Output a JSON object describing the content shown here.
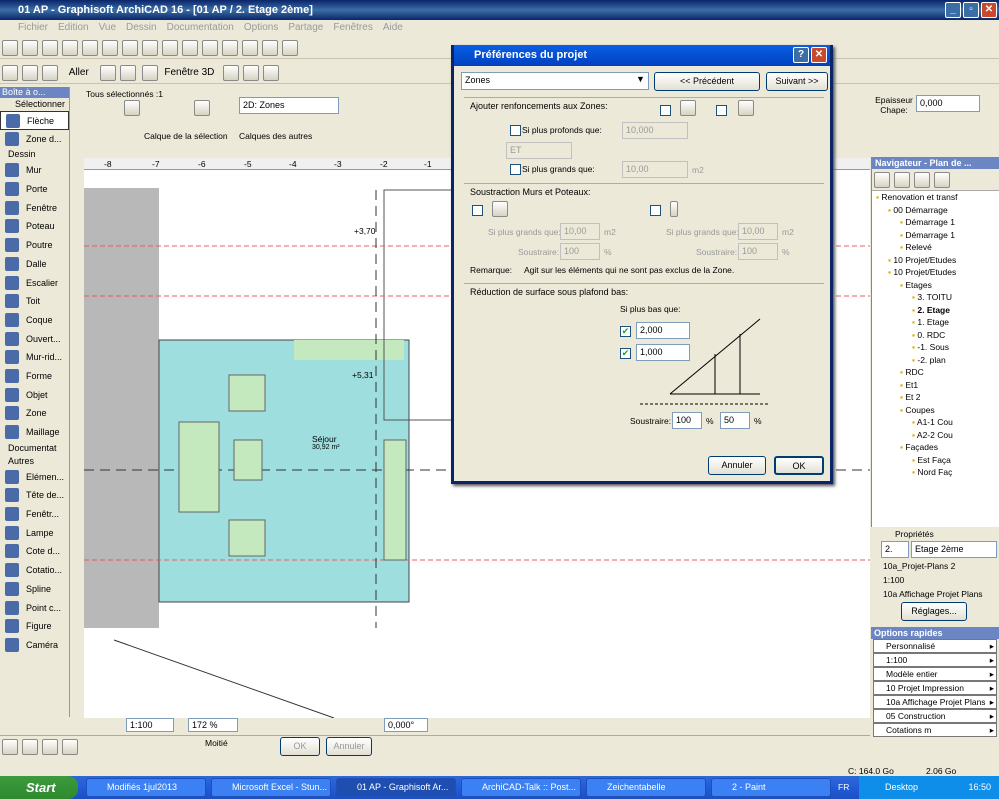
{
  "window": {
    "title": "01 AP - Graphisoft ArchiCAD 16 - [01 AP / 2. Etage 2ème]"
  },
  "menu": [
    "Fichier",
    "Edition",
    "Vue",
    "Dessin",
    "Documentation",
    "Options",
    "Partage",
    "Fenêtres",
    "Aide"
  ],
  "toolbar2": {
    "aller": "Aller",
    "fenetre3d": "Fenêtre 3D"
  },
  "toolbox": {
    "header": "Boîte à o...",
    "selection_section": "Sélectionner",
    "selection_tools": [
      "Flèche",
      "Zone d..."
    ],
    "dessin_section": "Dessin",
    "dessin_tools": [
      "Mur",
      "Porte",
      "Fenêtre",
      "Poteau",
      "Poutre",
      "Dalle",
      "Escalier",
      "Toit",
      "Coque",
      "Ouvert...",
      "Mur-rid...",
      "Forme",
      "Objet",
      "Zone",
      "Maillage"
    ],
    "documentation_section": "Documentat",
    "autres_section": "Autres",
    "autres_tools": [
      "Elémen...",
      "Tête de...",
      "Fenêtr...",
      "Lampe",
      "Cote d...",
      "Cotatio...",
      "Spline",
      "Point c...",
      "Figure",
      "Caméra"
    ]
  },
  "infobox": {
    "selected": "Tous sélectionnés :1",
    "view_dropdown": "2D: Zones",
    "calque_selection": "Calque de la sélection",
    "calque_autres": "Calques des autres",
    "epaisseur_label": "Epaisseur Chape:",
    "epaisseur_value": "0,000"
  },
  "ruler": [
    "-8",
    "-7",
    "-6",
    "-5",
    "-4",
    "-3",
    "-2",
    "-1"
  ],
  "plan": {
    "zone_name": "Séjour",
    "zone_area": "30,92 m²",
    "level1": "+3,70",
    "level2": "+5,31"
  },
  "dialog": {
    "title": "Préférences du projet",
    "dropdown": "Zones",
    "prev_button": "<< Précédent",
    "next_button": "Suivant >>",
    "sec1_title": "Ajouter renfoncements aux Zones:",
    "si_plus_profonds": "Si plus profonds que:",
    "profonds_value": "10,000",
    "et_value": "ET",
    "si_plus_grands": "Si plus grands que:",
    "grands_value": "10,00",
    "unit_m2": "m2",
    "sec2_title": "Soustraction Murs et Poteaux:",
    "sub_si_plus_grands": "Si plus grands que:",
    "sub_grands_value_left": "10,00",
    "sub_grands_value_right": "10,00",
    "soustraire_label": "Soustraire:",
    "soustraire_left": "100",
    "soustraire_right": "100",
    "unit_pct": "%",
    "remarque_label": "Remarque:",
    "remarque_text": "Agit sur les éléments qui ne sont pas exclus de la Zone.",
    "sec3_title": "Réduction de surface sous plafond bas:",
    "si_plus_bas": "Si plus bas que:",
    "bas_value1": "2,000",
    "bas_value2": "1,000",
    "sous_value1": "100",
    "sous_value2": "50",
    "cancel_button": "Annuler",
    "ok_button": "OK"
  },
  "navigator": {
    "title": "Navigateur - Plan de ...",
    "tree": [
      {
        "label": "Renovation et transf",
        "indent": 0
      },
      {
        "label": "00 Démarrage",
        "indent": 1
      },
      {
        "label": "Démarrage 1",
        "indent": 2
      },
      {
        "label": "Démarrage 1",
        "indent": 2
      },
      {
        "label": "Relevé",
        "indent": 2
      },
      {
        "label": "10 Projet/Etudes",
        "indent": 1
      },
      {
        "label": "10 Projet/Etudes",
        "indent": 1
      },
      {
        "label": "Etages",
        "indent": 2
      },
      {
        "label": "3. TOITU",
        "indent": 3
      },
      {
        "label": "2. Etage",
        "indent": 3
      },
      {
        "label": "1. Etage",
        "indent": 3
      },
      {
        "label": "0. RDC",
        "indent": 3
      },
      {
        "label": "-1. Sous",
        "indent": 3
      },
      {
        "label": "-2. plan",
        "indent": 3
      },
      {
        "label": "RDC",
        "indent": 2
      },
      {
        "label": "Et1",
        "indent": 2
      },
      {
        "label": "Et 2",
        "indent": 2
      },
      {
        "label": "Coupes",
        "indent": 2
      },
      {
        "label": "A1-1 Cou",
        "indent": 3
      },
      {
        "label": "A2-2 Cou",
        "indent": 3
      },
      {
        "label": "Façades",
        "indent": 2
      },
      {
        "label": "Est Faça",
        "indent": 3
      },
      {
        "label": "Nord Faç",
        "indent": 3
      }
    ]
  },
  "properties": {
    "title": "Propriétés",
    "id": "2.",
    "name": "Etage 2ème",
    "layer_combo": "10a_Projet-Plans 2",
    "scale": "1:100",
    "display": "10a Affichage Projet Plans",
    "settings_button": "Réglages..."
  },
  "options_rapides": {
    "title": "Options rapides",
    "items": [
      "Personnalisé",
      "1:100",
      "Modèle entier",
      "10 Projet Impression",
      "10a Affichage Projet Plans",
      "05 Construction",
      "Cotations m"
    ]
  },
  "bottom_toolbar": {
    "scale": "1:100",
    "zoom": "172 %",
    "angle": "0,000°",
    "modite": "Moitié",
    "ok": "OK",
    "annuler": "Annuler"
  },
  "status": {
    "disk": "C: 164.0 Go",
    "ram": "2.06 Go"
  },
  "taskbar": {
    "start": "Start",
    "tasks": [
      "Modifiés 1jul2013",
      "Microsoft Excel - Stun...",
      "01 AP - Graphisoft Ar...",
      "ArchiCAD-Talk :: Post...",
      "Zeichentabelle",
      "2 - Paint"
    ],
    "lang": "FR",
    "desktop": "Desktop",
    "clock": "16:50"
  }
}
